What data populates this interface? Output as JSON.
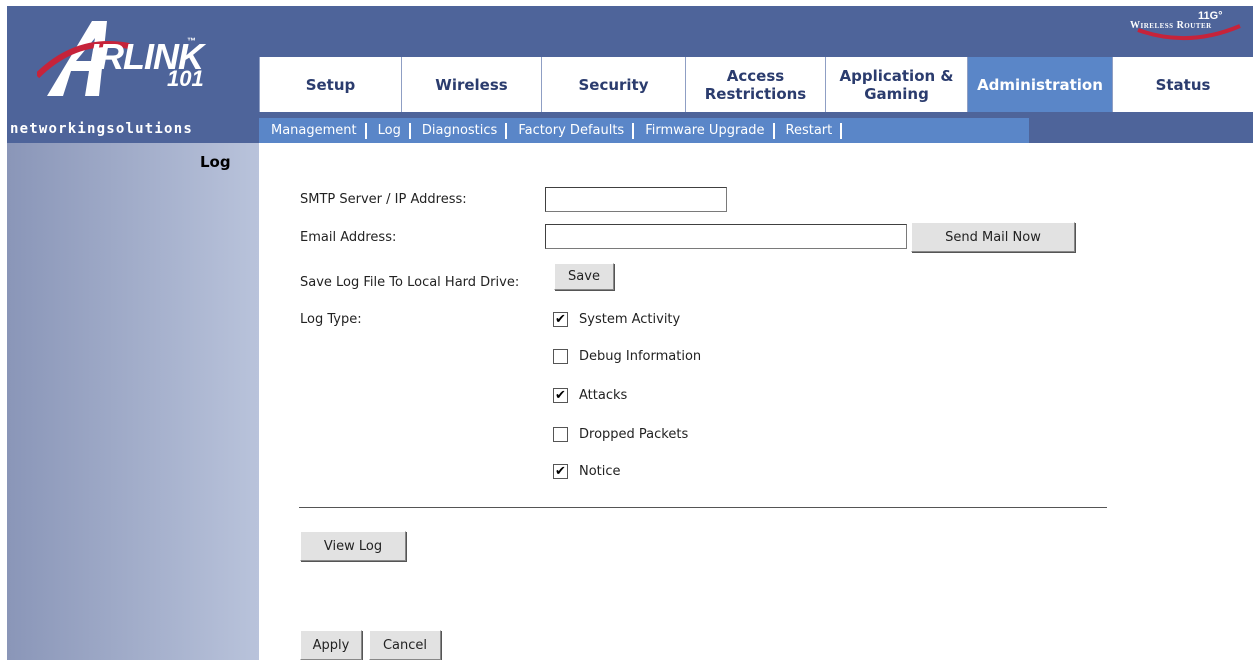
{
  "header": {
    "logo_word": "IRLINK",
    "logo_number": "101",
    "logo_tm": "™",
    "tagline": "networkingsolutions",
    "badge_mark": "11G°",
    "badge_text": "Wireless Router"
  },
  "tabs": [
    {
      "label": "Setup",
      "active": false
    },
    {
      "label": "Wireless",
      "active": false
    },
    {
      "label": "Security",
      "active": false
    },
    {
      "label": "Access Restrictions",
      "active": false
    },
    {
      "label": "Application & Gaming",
      "active": false
    },
    {
      "label": "Administration",
      "active": true
    },
    {
      "label": "Status",
      "active": false
    }
  ],
  "subnav": [
    "Management",
    "Log",
    "Diagnostics",
    "Factory Defaults",
    "Firmware Upgrade",
    "Restart"
  ],
  "section": {
    "title": "Log"
  },
  "form": {
    "smtp_label": "SMTP Server / IP Address:",
    "smtp_value": "",
    "email_label": "Email Address:",
    "email_value": "",
    "send_mail_button": "Send Mail Now",
    "save_log_label": "Save Log File To Local Hard Drive:",
    "save_button": "Save",
    "log_type_label": "Log Type:",
    "log_types": [
      {
        "label": "System Activity",
        "checked": true
      },
      {
        "label": "Debug Information",
        "checked": false
      },
      {
        "label": "Attacks",
        "checked": true
      },
      {
        "label": "Dropped Packets",
        "checked": false
      },
      {
        "label": "Notice",
        "checked": true
      }
    ],
    "view_log_button": "View Log",
    "apply_button": "Apply",
    "cancel_button": "Cancel"
  },
  "colors": {
    "banner": "#4e649a",
    "active_tab": "#5a86c8",
    "tab_text": "#2b3c6e"
  }
}
